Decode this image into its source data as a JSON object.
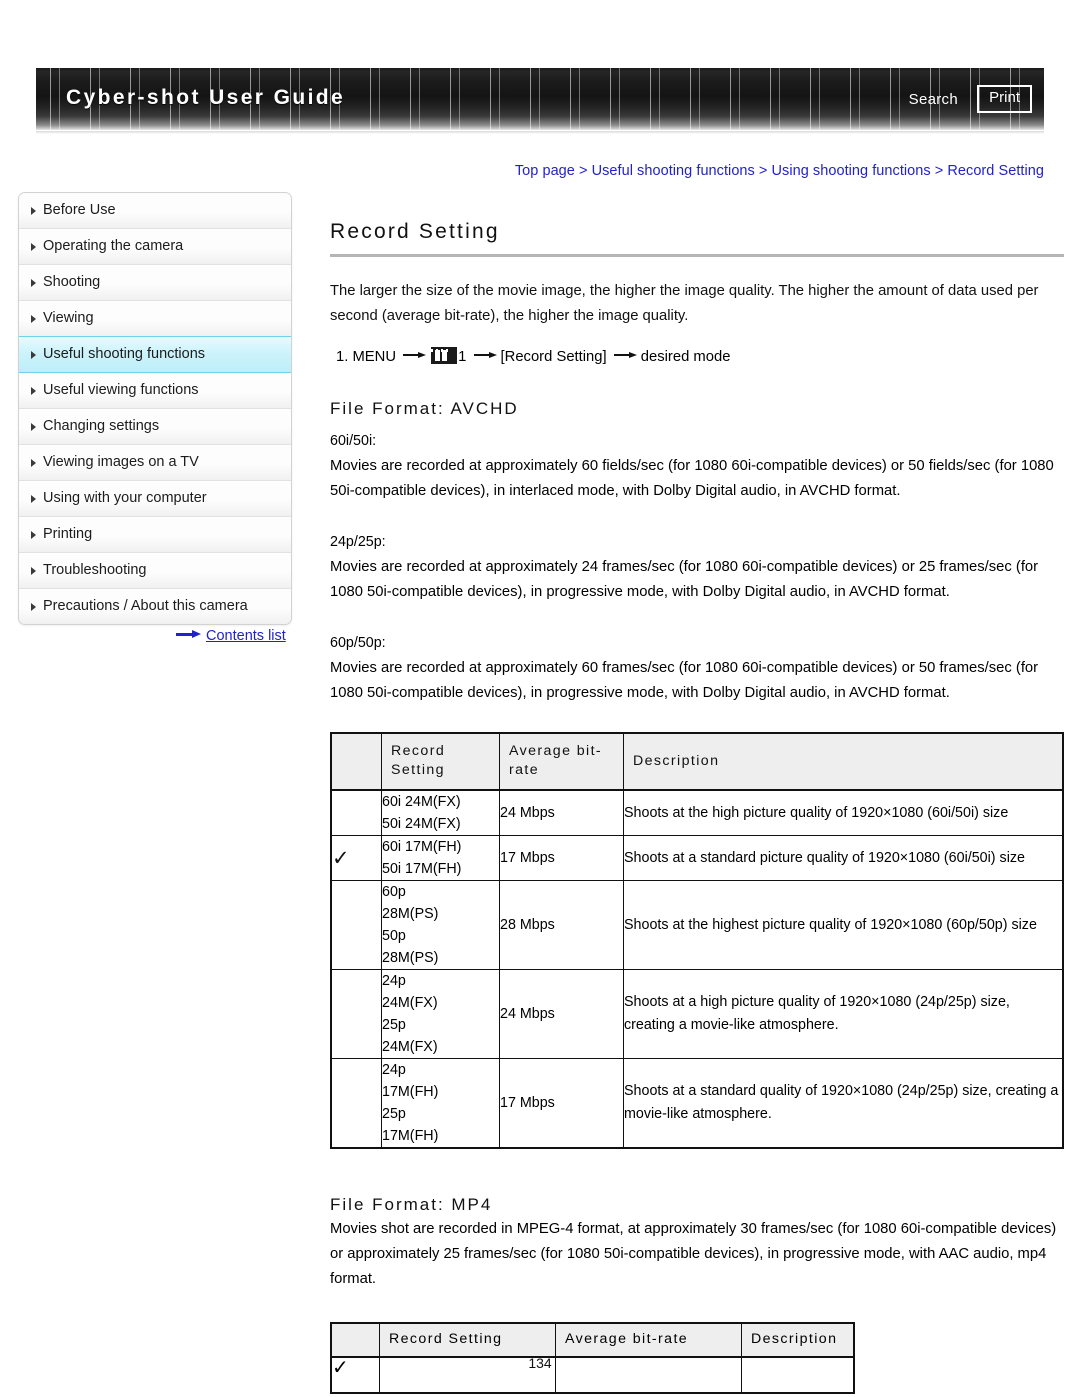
{
  "header": {
    "title": "Cyber-shot User Guide",
    "search_label": "Search",
    "print_label": "Print"
  },
  "breadcrumb": {
    "full": "Top page > Useful shooting functions > Using shooting functions > Record Setting",
    "items": [
      "Top page",
      "Useful shooting functions",
      "Using shooting functions",
      "Record Setting"
    ],
    "separator": ">"
  },
  "sidebar": {
    "items": [
      {
        "label": "Before Use",
        "active": false
      },
      {
        "label": "Operating the camera",
        "active": false
      },
      {
        "label": "Shooting",
        "active": false
      },
      {
        "label": "Viewing",
        "active": false
      },
      {
        "label": "Useful shooting functions",
        "active": true
      },
      {
        "label": "Useful viewing functions",
        "active": false
      },
      {
        "label": "Changing settings",
        "active": false
      },
      {
        "label": "Viewing images on a TV",
        "active": false
      },
      {
        "label": "Using with your computer",
        "active": false
      },
      {
        "label": "Printing",
        "active": false
      },
      {
        "label": "Troubleshooting",
        "active": false
      },
      {
        "label": "Precautions / About this camera",
        "active": false
      }
    ],
    "contents_link": "Contents list"
  },
  "main": {
    "page_title": "Record Setting",
    "intro": "The larger the size of the movie image, the higher the image quality. The higher the amount of data used per second (average bit-rate), the higher the image quality.",
    "step": {
      "number": "1.",
      "menu_label": "MENU",
      "icon_name": "movie-mode-icon",
      "icon_suffix": "1",
      "bracket_item": "[Record Setting]",
      "tail": "desired mode"
    },
    "avchd": {
      "title": "File Format: AVCHD",
      "blocks": [
        {
          "label": "60i/50i:",
          "text": "Movies are recorded at approximately 60 fields/sec (for 1080 60i-compatible devices) or 50 fields/sec (for 1080 50i-compatible devices), in interlaced mode, with Dolby Digital audio, in AVCHD format."
        },
        {
          "label": "24p/25p:",
          "text": "Movies are recorded at approximately 24 frames/sec (for 1080 60i-compatible devices) or 25 frames/sec (for 1080 50i-compatible devices), in progressive mode, with Dolby Digital audio, in AVCHD format."
        },
        {
          "label": "60p/50p:",
          "text": "Movies are recorded at approximately 60 frames/sec (for 1080 60i-compatible devices) or 50 frames/sec (for 1080 50i-compatible devices), in progressive mode, with Dolby Digital audio, in AVCHD format."
        }
      ],
      "table": {
        "headers": [
          "",
          "Record Setting",
          "Average bit-rate",
          "Description"
        ],
        "rows": [
          {
            "checked": false,
            "setting": "60i 24M(FX)\n50i 24M(FX)",
            "bitrate": "24 Mbps",
            "description": "Shoots at the high picture quality of 1920×1080 (60i/50i) size"
          },
          {
            "checked": true,
            "setting": "60i 17M(FH)\n50i 17M(FH)",
            "bitrate": "17 Mbps",
            "description": "Shoots at a standard picture quality of 1920×1080 (60i/50i) size"
          },
          {
            "checked": false,
            "setting": "60p\n28M(PS)\n50p\n28M(PS)",
            "bitrate": "28 Mbps",
            "description": "Shoots at the highest picture quality of 1920×1080 (60p/50p) size"
          },
          {
            "checked": false,
            "setting": "24p\n24M(FX)\n25p\n24M(FX)",
            "bitrate": "24 Mbps",
            "description": "Shoots at a high picture quality of 1920×1080 (24p/25p) size, creating a movie-like atmosphere."
          },
          {
            "checked": false,
            "setting": "24p\n17M(FH)\n25p\n17M(FH)",
            "bitrate": "17 Mbps",
            "description": "Shoots at a standard quality of 1920×1080 (24p/25p) size, creating a movie-like atmosphere."
          }
        ]
      }
    },
    "mp4": {
      "title": "File Format: MP4",
      "text": "Movies shot are recorded in MPEG-4 format, at approximately 30 frames/sec (for 1080 60i-compatible devices) or approximately 25 frames/sec (for 1080 50i-compatible devices), in progressive mode, with AAC audio, mp4 format.",
      "table": {
        "headers": [
          "",
          "Record Setting",
          "Average bit-rate",
          "Description"
        ],
        "rows": [
          {
            "checked": true,
            "setting": "",
            "bitrate": "",
            "description": ""
          }
        ]
      }
    }
  },
  "footer": {
    "page_number": "134"
  },
  "glyphs": {
    "check": "✓",
    "arrow": "→"
  },
  "colors": {
    "link": "#2222cc",
    "active_sidebar": "#bdeef9",
    "table_header_bg": "#eeeeee",
    "rule": "#b5b5b5"
  }
}
